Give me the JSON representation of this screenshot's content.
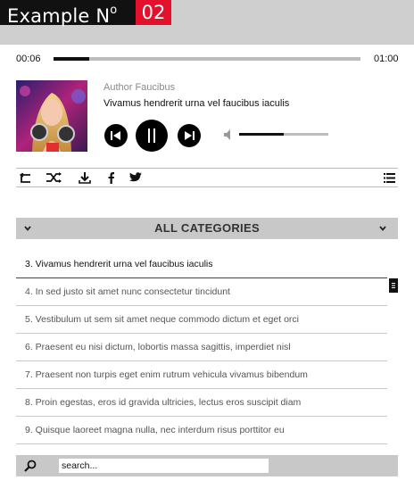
{
  "header": {
    "title": "Example N",
    "title_sup": "o",
    "number": "02",
    "accent": "#e4112d"
  },
  "player": {
    "time_current": "00:06",
    "time_total": "01:00",
    "progress_fraction": 0.116,
    "author": "Author Faucibus",
    "track_title": "Vivamus hendrerit urna vel faucibus iaculis",
    "volume_fraction": 0.5,
    "controls": [
      "prev-icon",
      "pause-icon",
      "next-icon"
    ],
    "volume_icon": "speaker-icon"
  },
  "toolbar": {
    "icons": [
      "repeat-icon",
      "shuffle-icon",
      "download-icon",
      "facebook-icon",
      "twitter-icon",
      "playlist-icon"
    ]
  },
  "categories": {
    "label": "ALL CATEGORIES"
  },
  "playlist": {
    "items": [
      "3. Vivamus hendrerit urna vel faucibus iaculis",
      "4. In sed justo sit amet nunc consectetur tincidunt",
      "5. Vestibulum ut sem sit amet neque commodo dictum et eget orci",
      "6. Praesent eu nisi dictum, lobortis massa sagittis, imperdiet nisl",
      "7. Praesent non turpis eget enim rutrum vehicula vivamus bibendum",
      "8. Proin egestas, eros id gravida ultricies, lectus eros suscipit diam",
      "9. Quisque laoreet magna nulla, nec interdum risus porttitor eu"
    ]
  },
  "search": {
    "placeholder": "search..."
  }
}
